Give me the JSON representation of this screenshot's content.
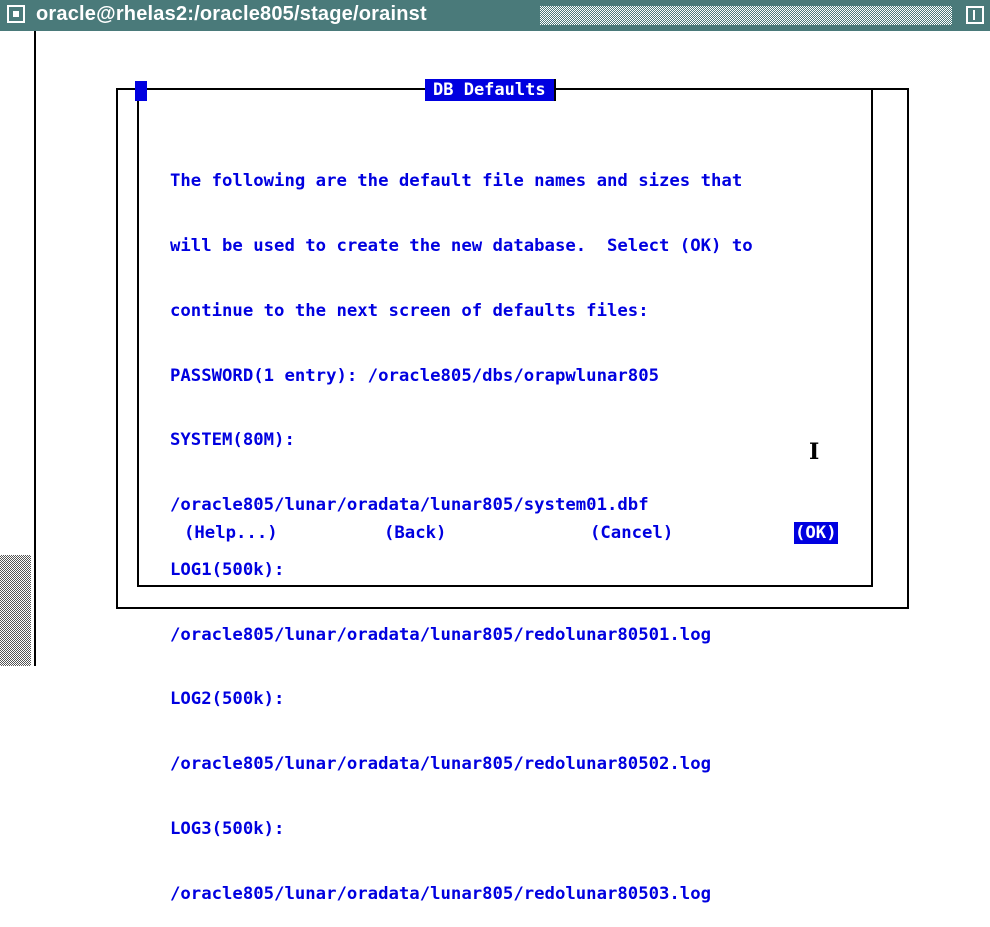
{
  "window": {
    "title": "oracle@rhelas2:/oracle805/stage/orainst"
  },
  "dialog": {
    "title": "DB Defaults",
    "body_lines": [
      "The following are the default file names and sizes that",
      "will be used to create the new database.  Select (OK) to",
      "continue to the next screen of defaults files:",
      "PASSWORD(1 entry): /oracle805/dbs/orapwlunar805",
      "SYSTEM(80M):",
      "/oracle805/lunar/oradata/lunar805/system01.dbf",
      "LOG1(500k):",
      "/oracle805/lunar/oradata/lunar805/redolunar80501.log",
      "LOG2(500k):",
      "/oracle805/lunar/oradata/lunar805/redolunar80502.log",
      "LOG3(500k):",
      "/oracle805/lunar/oradata/lunar805/redolunar80503.log"
    ],
    "buttons": {
      "help": "(Help...)",
      "back": "(Back)",
      "cancel": "(Cancel)",
      "ok": "(OK)"
    }
  },
  "colors": {
    "titlebar": "#4a7a7a",
    "text": "#0000e0",
    "highlight": "#0000e0"
  },
  "icons": [
    "window-menu-icon",
    "window-maximize-icon",
    "text-cursor-icon"
  ]
}
